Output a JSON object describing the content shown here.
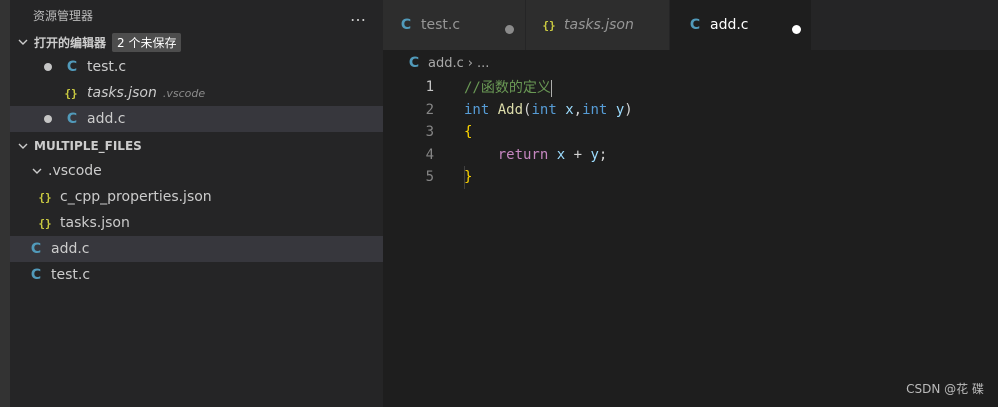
{
  "explorer": {
    "title": "资源管理器",
    "more_icon": "…",
    "open_editors": {
      "label": "打开的编辑器",
      "badge": "2 个未保存",
      "items": [
        {
          "icon": "C",
          "name": "test.c",
          "dirty": true
        },
        {
          "icon": "{}",
          "name": "tasks.json",
          "description": ".vscode",
          "italic": true
        },
        {
          "icon": "C",
          "name": "add.c",
          "dirty": true,
          "selected": true
        }
      ]
    },
    "folder": {
      "label": "MULTIPLE_FILES",
      "subfolder": ".vscode",
      "children": [
        {
          "icon": "{}",
          "name": "c_cpp_properties.json"
        },
        {
          "icon": "{}",
          "name": "tasks.json"
        }
      ],
      "files": [
        {
          "icon": "C",
          "name": "add.c",
          "selected": true
        },
        {
          "icon": "C",
          "name": "test.c"
        }
      ]
    }
  },
  "tabs": [
    {
      "icon": "C",
      "label": "test.c",
      "dirty": true
    },
    {
      "icon": "{}",
      "label": "tasks.json",
      "italic": true
    },
    {
      "icon": "C",
      "label": "add.c",
      "dirty": true,
      "active": true
    }
  ],
  "breadcrumb": {
    "icon": "C",
    "file": "add.c",
    "separator": "›",
    "rest": "..."
  },
  "editor": {
    "active_line": 1,
    "line_numbers": [
      "1",
      "2",
      "3",
      "4",
      "5"
    ],
    "lines": [
      [
        {
          "t": "comment",
          "v": "//函数的定义"
        }
      ],
      [
        {
          "t": "keyword",
          "v": "int"
        },
        {
          "t": "plain",
          "v": " "
        },
        {
          "t": "func",
          "v": "Add"
        },
        {
          "t": "plain",
          "v": "("
        },
        {
          "t": "keyword",
          "v": "int"
        },
        {
          "t": "plain",
          "v": " "
        },
        {
          "t": "param",
          "v": "x"
        },
        {
          "t": "plain",
          "v": ","
        },
        {
          "t": "keyword",
          "v": "int"
        },
        {
          "t": "plain",
          "v": " "
        },
        {
          "t": "param",
          "v": "y"
        },
        {
          "t": "plain",
          "v": ")"
        }
      ],
      [
        {
          "t": "brace",
          "v": "{"
        }
      ],
      [
        {
          "t": "plain",
          "v": "    "
        },
        {
          "t": "control",
          "v": "return"
        },
        {
          "t": "plain",
          "v": " "
        },
        {
          "t": "param",
          "v": "x"
        },
        {
          "t": "plain",
          "v": " + "
        },
        {
          "t": "param",
          "v": "y"
        },
        {
          "t": "plain",
          "v": ";"
        }
      ],
      [
        {
          "t": "brace",
          "v": "}"
        }
      ]
    ]
  },
  "watermark": "CSDN @花 碟",
  "colors": {
    "c_icon": "#519aba",
    "json_icon": "#cbcb41",
    "background": "#1e1e1e",
    "sidebar": "#252526",
    "selection": "#37373d"
  }
}
